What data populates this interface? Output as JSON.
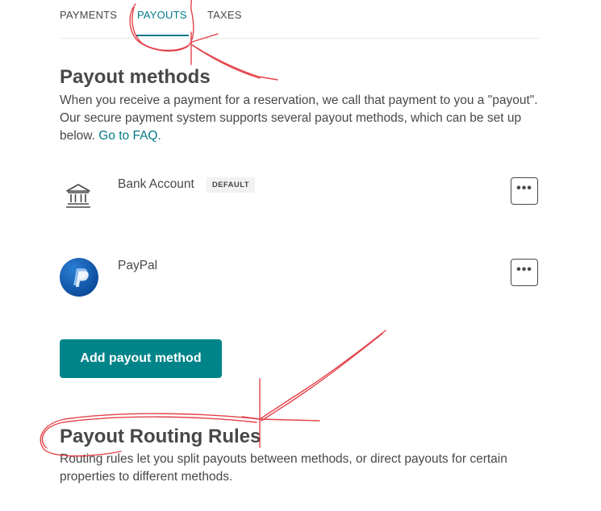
{
  "tabs": [
    {
      "label": "PAYMENTS",
      "active": false
    },
    {
      "label": "PAYOUTS",
      "active": true
    },
    {
      "label": "TAXES",
      "active": false
    }
  ],
  "payout_methods": {
    "title": "Payout methods",
    "description": "When you receive a payment for a reservation, we call that payment to you a \"payout\". Our secure payment system supports several payout methods, which can be set up below.",
    "faq_link": "Go to FAQ.",
    "methods": [
      {
        "name": "Bank Account",
        "badge": "DEFAULT",
        "icon": "bank-icon",
        "more_label": "•••"
      },
      {
        "name": "PayPal",
        "badge": "",
        "icon": "paypal-icon",
        "more_label": "•••"
      }
    ],
    "add_button": "Add payout method"
  },
  "routing_rules": {
    "title": "Payout Routing Rules",
    "description": "Routing rules let you split payouts between methods, or direct payouts for certain properties to different methods."
  },
  "colors": {
    "accent": "#007a87",
    "button": "#008489",
    "text": "#484848",
    "annotation": "#e0202a"
  }
}
